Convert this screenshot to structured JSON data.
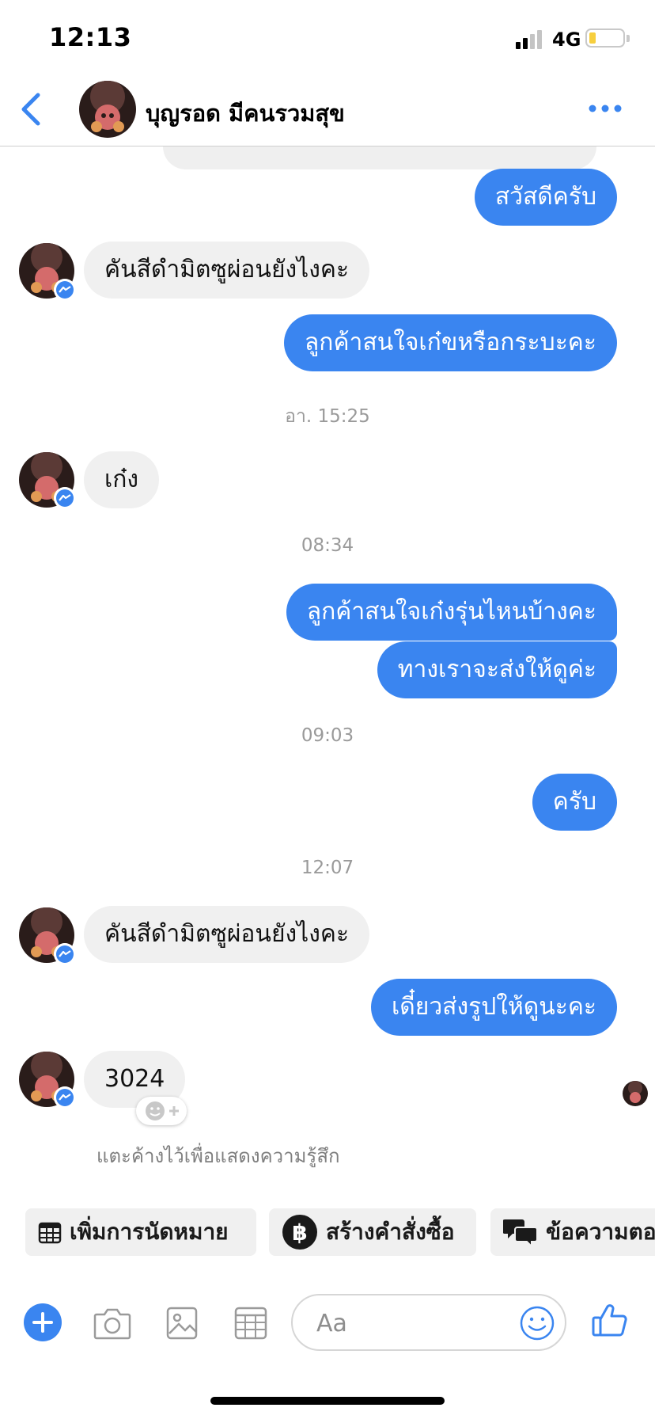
{
  "status_bar": {
    "time": "12:13",
    "network": "4G",
    "battery_level_percent": 15
  },
  "header": {
    "contact_name": "บุญรอด มีคนรวมสุข"
  },
  "messages": [
    {
      "text": "สวัสดีครับ"
    },
    {
      "text": "คันสีดำมิตซูผ่อนยังไงคะ"
    },
    {
      "text": "ลูกค้าสนใจเก๋ขหรือกระบะคะ"
    },
    {
      "text": "อา. 15:25"
    },
    {
      "text": "เก๋ง"
    },
    {
      "text": "08:34"
    },
    {
      "text": "ลูกค้าสนใจเก๋งรุ่นไหนบ้างคะ"
    },
    {
      "text": "ทางเราจะส่งให้ดูค่ะ"
    },
    {
      "text": "09:03"
    },
    {
      "text": "ครับ"
    },
    {
      "text": "12:07"
    },
    {
      "text": "คันสีดำมิตซูผ่อนยังไงคะ"
    },
    {
      "text": "เดี๋ยวส่งรูปให้ดูนะคะ"
    },
    {
      "text": "3024"
    }
  ],
  "reaction_hint": "แตะค้างไว้เพื่อแสดงความรู้สึก",
  "quick_replies": [
    {
      "label": "เพิ่มการนัดหมาย",
      "icon": "calendar-icon"
    },
    {
      "label": "สร้างคำสั่งซื้อ",
      "icon": "baht-icon"
    },
    {
      "label": "ข้อความตอ",
      "icon": "chat-bubbles-icon"
    }
  ],
  "composer": {
    "placeholder": "Aa"
  },
  "colors": {
    "accent": "#3a85f0",
    "incoming_bubble": "#f0f0f0",
    "timestamp": "#9a9a9a"
  }
}
